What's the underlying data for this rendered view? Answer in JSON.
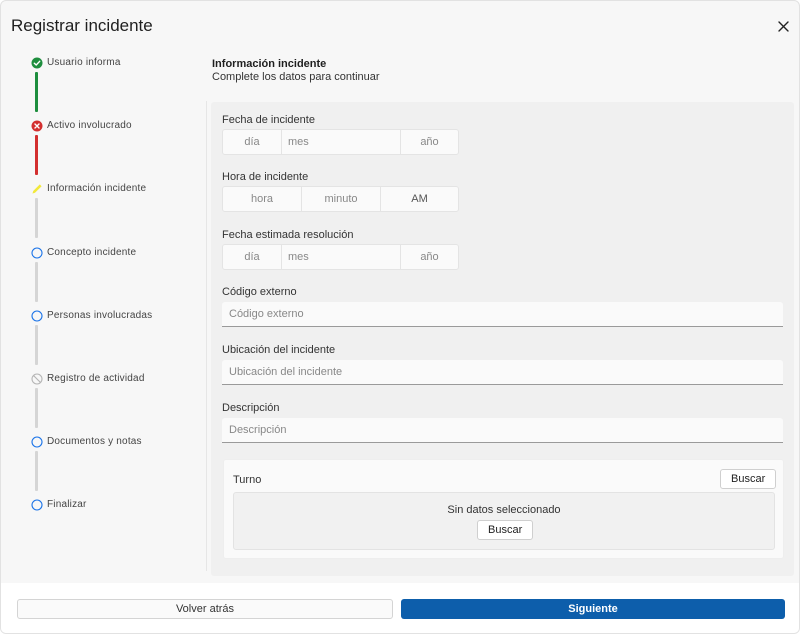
{
  "dialog": {
    "title": "Registrar incidente",
    "close_icon": "close-icon"
  },
  "colors": {
    "done": "#1e8e3e",
    "error": "#d32f2f",
    "current": "#f2e93a",
    "pending": "#1a73e8",
    "disabled": "#b5b5b5",
    "primary": "#0d5eab"
  },
  "stepper": {
    "steps": [
      {
        "label": "Usuario informa",
        "status": "done",
        "icon": "check-circle-icon"
      },
      {
        "label": "Activo involucrado",
        "status": "error",
        "icon": "error-circle-icon"
      },
      {
        "label": "Información incidente",
        "status": "current",
        "icon": "pencil-icon"
      },
      {
        "label": "Concepto incidente",
        "status": "pending",
        "icon": "circle-icon"
      },
      {
        "label": "Personas involucradas",
        "status": "pending",
        "icon": "circle-icon"
      },
      {
        "label": "Registro de actividad",
        "status": "disabled",
        "icon": "blocked-circle-icon"
      },
      {
        "label": "Documentos y notas",
        "status": "pending",
        "icon": "circle-icon"
      },
      {
        "label": "Finalizar",
        "status": "pending",
        "icon": "circle-icon"
      }
    ]
  },
  "section": {
    "title": "Información incidente",
    "subtitle": "Complete los datos para continuar"
  },
  "form": {
    "fecha_incidente": {
      "label": "Fecha de incidente",
      "day": "día",
      "month": "mes",
      "year": "año"
    },
    "hora_incidente": {
      "label": "Hora de incidente",
      "hour": "hora",
      "minute": "minuto",
      "period": "AM"
    },
    "fecha_resolucion": {
      "label": "Fecha estimada resolución",
      "day": "día",
      "month": "mes",
      "year": "año"
    },
    "codigo_externo": {
      "label": "Código externo",
      "placeholder": "Código externo"
    },
    "ubicacion": {
      "label": "Ubicación del incidente",
      "placeholder": "Ubicación del incidente"
    },
    "descripcion": {
      "label": "Descripción",
      "placeholder": "Descripción"
    },
    "turno": {
      "label": "Turno",
      "search_label": "Buscar",
      "empty_text": "Sin datos seleccionado",
      "empty_search_label": "Buscar"
    }
  },
  "footer": {
    "back_label": "Volver atrás",
    "next_label": "Siguiente"
  }
}
